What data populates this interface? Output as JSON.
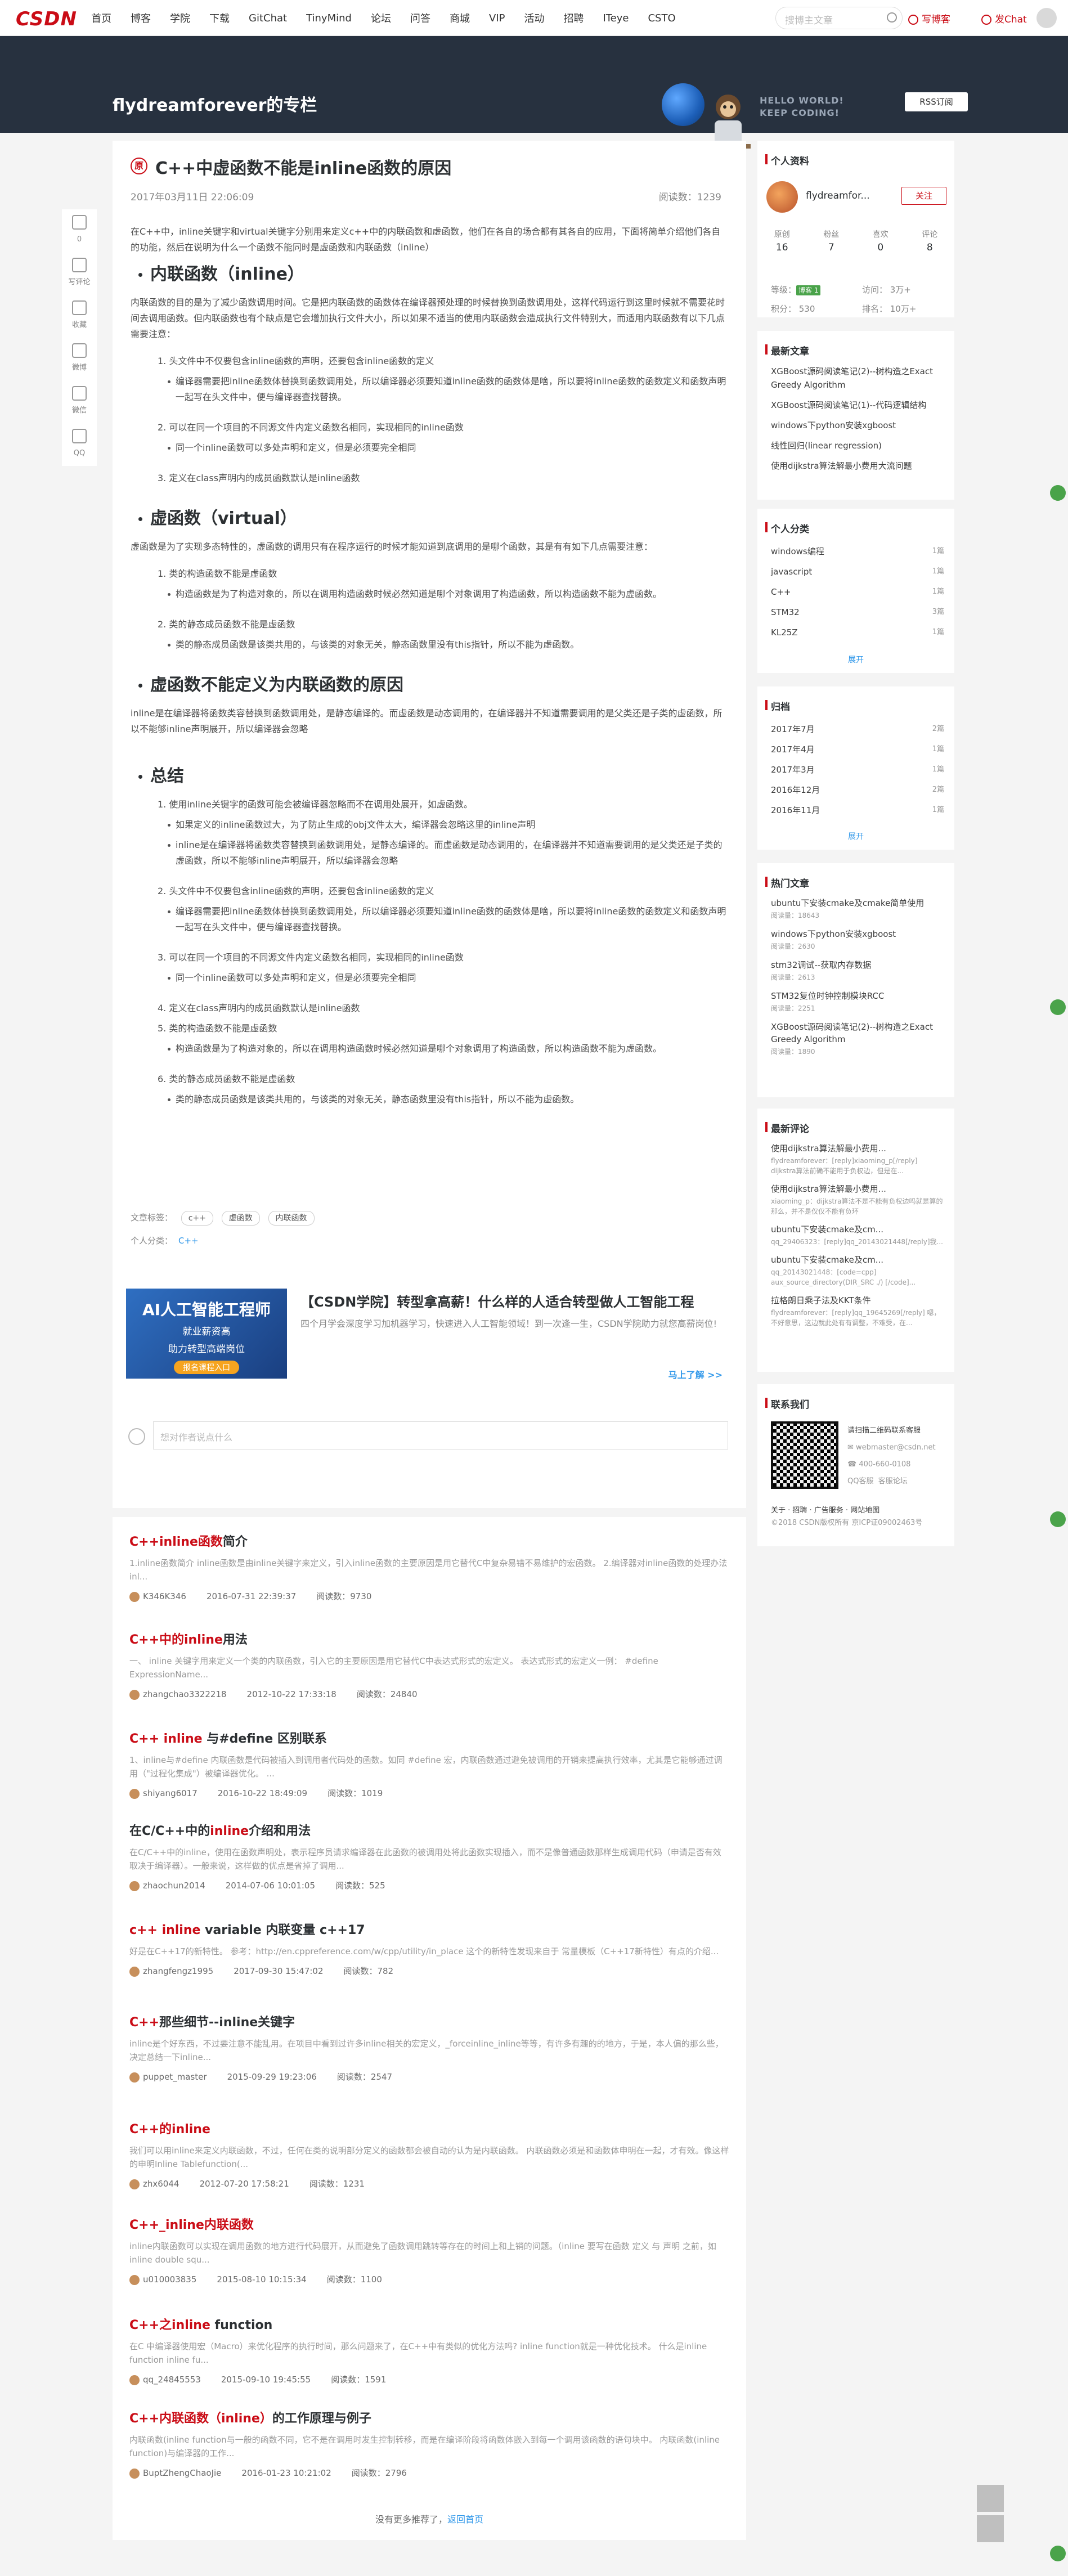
{
  "nav": {
    "logo": "CSDN",
    "links": [
      "首页",
      "博客",
      "学院",
      "下载",
      "GitChat",
      "TinyMind",
      "论坛",
      "问答",
      "商城",
      "VIP",
      "活动",
      "招聘",
      "ITeye",
      "CSTO"
    ],
    "search_placeholder": "搜博主文章",
    "write": "写博客",
    "chat": "发Chat"
  },
  "banner": {
    "title": "flydreamforever的专栏",
    "hello": [
      "HELLO WORLD!",
      "KEEP CODING!"
    ],
    "rss": "RSS订阅"
  },
  "lefttools": [
    {
      "icon": "thumb-up-icon",
      "label": "0"
    },
    {
      "icon": "comment-icon",
      "label": "写评论"
    },
    {
      "icon": "bookmark-icon",
      "label": "收藏"
    },
    {
      "icon": "weibo-icon",
      "label": "微博"
    },
    {
      "icon": "wechat-icon",
      "label": "微信"
    },
    {
      "icon": "qq-icon",
      "label": "QQ"
    }
  ],
  "article": {
    "badge": "原",
    "title": "C++中虚函数不能是inline函数的原因",
    "date": "2017年03月11日 22:06:09",
    "reads": "阅读数：1239",
    "intro": "在C++中，inline关键字和virtual关键字分别用来定义c++中的内联函数和虚函数，他们在各自的场合都有其各自的应用，下面将简单介绍他们各自的功能，然后在说明为什么一个函数不能同时是虚函数和内联函数（inline）",
    "s1_title": "内联函数（inline）",
    "s1_p": "内联函数的目的是为了减少函数调用时间。它是把内联函数的函数体在编译器预处理的时候替换到函数调用处，这样代码运行到这里时候就不需要花时间去调用函数。但内联函数也有个缺点是它会增加执行文件大小，所以如果不适当的使用内联函数会造成执行文件特别大，而适用内联函数有以下几点需要注意：",
    "s1_items": [
      {
        "level": 1,
        "text": "1. 头文件中不仅要包含inline函数的声明，还要包含inline函数的定义"
      },
      {
        "level": 2,
        "text": "编译器需要把inline函数体替换到函数调用处，所以编译器必须要知道inline函数的函数体是啥，所以要将inline函数的函数定义和函数声明一起写在头文件中，便与编译器查找替换。"
      },
      {
        "level": 1,
        "text": "2. 可以在同一个项目的不同源文件内定义函数名相同，实现相同的inline函数"
      },
      {
        "level": 2,
        "text": "同一个inline函数可以多处声明和定义，但是必须要完全相同"
      },
      {
        "level": 1,
        "text": "3. 定义在class声明内的成员函数默认是inline函数"
      }
    ],
    "s2_title": "虚函数（virtual）",
    "s2_p": "虚函数是为了实现多态特性的，虚函数的调用只有在程序运行的时候才能知道到底调用的是哪个函数，其是有有如下几点需要注意：",
    "s2_items": [
      {
        "level": 1,
        "text": "1. 类的构造函数不能是虚函数"
      },
      {
        "level": 2,
        "text": "构造函数是为了构造对象的，所以在调用构造函数时候必然知道是哪个对象调用了构造函数，所以构造函数不能为虚函数。"
      },
      {
        "level": 1,
        "text": "2. 类的静态成员函数不能是虚函数"
      },
      {
        "level": 2,
        "text": "类的静态成员函数是该类共用的，与该类的对象无关，静态函数里没有this指针，所以不能为虚函数。"
      }
    ],
    "s3_title": "虚函数不能定义为内联函数的原因",
    "s3_p": "inline是在编译器将函数类容替换到函数调用处，是静态编译的。而虚函数是动态调用的，在编译器并不知道需要调用的是父类还是子类的虚函数，所以不能够inline声明展开，所以编译器会忽略",
    "s4_title": "总结",
    "s4_items": [
      {
        "level": 1,
        "text": "1. 使用inline关键字的函数可能会被编译器忽略而不在调用处展开，如虚函数。"
      },
      {
        "level": 2,
        "text": "如果定义的inline函数过大，为了防止生成的obj文件太大，编译器会忽略这里的inline声明"
      },
      {
        "level": 2,
        "text": "inline是在编译器将函数类容替换到函数调用处，是静态编译的。而虚函数是动态调用的，在编译器并不知道需要调用的是父类还是子类的虚函数，所以不能够inline声明展开，所以编译器会忽略"
      },
      {
        "level": 1,
        "text": "2. 头文件中不仅要包含inline函数的声明，还要包含inline函数的定义"
      },
      {
        "level": 2,
        "text": "编译器需要把inline函数体替换到函数调用处，所以编译器必须要知道inline函数的函数体是啥，所以要将inline函数的函数定义和函数声明一起写在头文件中，便与编译器查找替换。"
      },
      {
        "level": 1,
        "text": "3. 可以在同一个项目的不同源文件内定义函数名相同，实现相同的inline函数"
      },
      {
        "level": 2,
        "text": "同一个inline函数可以多处声明和定义，但是必须要完全相同"
      },
      {
        "level": 1,
        "text": "4. 定义在class声明内的成员函数默认是inline函数"
      },
      {
        "level": 1,
        "text": "5. 类的构造函数不能是虚函数"
      },
      {
        "level": 2,
        "text": "构造函数是为了构造对象的，所以在调用构造函数时候必然知道是哪个对象调用了构造函数，所以构造函数不能为虚函数。"
      },
      {
        "level": 1,
        "text": "6. 类的静态成员函数不能是虚函数"
      },
      {
        "level": 2,
        "text": "类的静态成员函数是该类共用的，与该类的对象无关，静态函数里没有this指针，所以不能为虚函数。"
      }
    ],
    "tags_label": "文章标签：",
    "tags": [
      "c++",
      "虚函数",
      "内联函数"
    ],
    "category_label": "个人分类：",
    "category": "C++"
  },
  "ad": {
    "img_big": "AI人工智能工程师",
    "img_sm1": "就业薪资高",
    "img_sm2": "助力转型高端岗位",
    "img_btn": "报名课程入口",
    "title": "【CSDN学院】转型拿高薪！什么样的人适合转型做人工智能工程",
    "desc": "四个月学会深度学习加机器学习，快速进入人工智能领域！到一次逢一生，CSDN学院助力就您高薪岗位!",
    "more": "马上了解 >>"
  },
  "comment": {
    "placeholder": "想对作者说点什么"
  },
  "related": [
    {
      "title_pre": "",
      "title_hl": "C++inline函数",
      "title_post": "简介",
      "desc": "1.inline函数简介 inline函数是由inline关键字来定义，引入inline函数的主要原因是用它替代C中复杂易错不易维护的宏函数。 2.编译器对inline函数的处理办法 inl...",
      "user": "K346K346",
      "date": "2016-07-31 22:39:37",
      "reads": "阅读数：9730"
    },
    {
      "title_pre": "",
      "title_hl": "C++中的inline",
      "title_post": "用法",
      "desc": "一、 inline 关键字用来定义一个类的内联函数，引入它的主要原因是用它替代C中表达式形式的宏定义。         表达式形式的宏定义一例：    #define ExpressionName...",
      "user": "zhangchao3322218",
      "date": "2012-10-22 17:33:18",
      "reads": "阅读数：24840"
    },
    {
      "title_pre": "",
      "title_hl": "C++ inline",
      "title_post": " 与#define 区别联系",
      "desc": "1、inline与#define 内联函数是代码被插入到调用者代码处的函数。如同 #define 宏，内联函数通过避免被调用的开销来提高执行效率，尤其是它能够通过调用（\"过程化集成\"）被编译器优化。 ...",
      "user": "shiyang6017",
      "date": "2016-10-22 18:49:09",
      "reads": "阅读数：1019"
    },
    {
      "title_pre": "在C/C++中的",
      "title_hl": "inline",
      "title_post": "介绍和用法",
      "desc": "在C/C++中的inline，使用在函数声明处，表示程序员请求编译器在此函数的被调用处将此函数实现插入，而不是像普通函数那样生成调用代码（申请是否有效取决于编译器）。一般来说，这样做的优点是省掉了调用...",
      "user": "zhaochun2014",
      "date": "2014-07-06 10:01:05",
      "reads": "阅读数：525"
    },
    {
      "title_pre": "",
      "title_hl": "c++ inline",
      "title_post": " variable 内联变量 c++17",
      "desc": "好是在C++17的新特性。 参考：http://en.cppreference.com/w/cpp/utility/in_place 这个的新特性发现来自于 常量模板（C++17新特性）有点的介绍...",
      "user": "zhangfengz1995",
      "date": "2017-09-30 15:47:02",
      "reads": "阅读数：782"
    },
    {
      "title_pre": "",
      "title_hl": "C++",
      "title_post": "那些细节--inline关键字",
      "desc": "inline是个好东西，不过要注意不能乱用。在项目中看到过许多inline相关的宏定义，_forceinline_inline等等，有许多有趣的的地方，于是，本人偏的那么些，决定总结一下inline...",
      "user": "puppet_master",
      "date": "2015-09-29 19:23:06",
      "reads": "阅读数：2547"
    },
    {
      "title_pre": "",
      "title_hl": "C++的inline",
      "title_post": "",
      "desc": "我们可以用inline来定义内联函数，不过，任何在类的说明部分定义的函数都会被自动的认为是内联函数。 内联函数必须是和函数体申明在一起，才有效。像这样的申明Inline Tablefunction(...",
      "user": "zhx6044",
      "date": "2012-07-20 17:58:21",
      "reads": "阅读数：1231"
    },
    {
      "title_pre": "",
      "title_hl": "C++_inline内联函数",
      "title_post": "",
      "desc": "inline内联函数可以实现在调用函数的地方进行代码展开，从而避免了函数调用跳转等存在的时间上和上销的问题。（inline 要写在函数 定义 与 声明 之前，如 inline double squ...",
      "user": "u010003835",
      "date": "2015-08-10 10:15:34",
      "reads": "阅读数：1100"
    },
    {
      "title_pre": "",
      "title_hl": "C++之inline",
      "title_post": " function",
      "desc": "在C 中编译器使用宏（Macro）来优化程序的执行时间，那么问题来了，在C++中有类似的优化方法吗? inline function就是一种优化技术。 什么是inline function inline fu...",
      "user": "qq_24845553",
      "date": "2015-09-10 19:45:55",
      "reads": "阅读数：1591"
    },
    {
      "title_pre": "",
      "title_hl": "C++内联函数（inline）",
      "title_post": "的工作原理与例子",
      "desc": "内联函数(inline function与一般的函数不同，它不是在调用时发生控制转移，而是在编译阶段将函数体嵌入到每一个调用该函数的语句块中。 内联函数(inline function)与编译器的工作...",
      "user": "BuptZhengChaoJie",
      "date": "2016-01-23 10:21:02",
      "reads": "阅读数：2796"
    }
  ],
  "related_end": {
    "text": "没有更多推荐了，",
    "link": "返回首页"
  },
  "profile": {
    "head": "个人资料",
    "name": "flydreamfor...",
    "follow": "关注",
    "stats": [
      {
        "label": "原创",
        "value": "16"
      },
      {
        "label": "粉丝",
        "value": "7"
      },
      {
        "label": "喜欢",
        "value": "0"
      },
      {
        "label": "评论",
        "value": "8"
      }
    ],
    "grade_label": "等级：",
    "grade_badge": "博客 1",
    "points": "积分：  530",
    "visits": "访问：  3万+",
    "rank": "排名：  10万+"
  },
  "latest": {
    "head": "最新文章",
    "items": [
      "XGBoost源码阅读笔记(2)--树构造之Exact Greedy Algorithm",
      "XGBoost源码阅读笔记(1)--代码逻辑结构",
      "windows下python安装xgboost",
      "线性回归(linear regression)",
      "使用dijkstra算法解最小费用大流问题"
    ]
  },
  "categories": {
    "head": "个人分类",
    "items": [
      {
        "name": "windows编程",
        "count": "1篇"
      },
      {
        "name": "javascript",
        "count": "1篇"
      },
      {
        "name": "C++",
        "count": "1篇"
      },
      {
        "name": "STM32",
        "count": "3篇"
      },
      {
        "name": "KL25Z",
        "count": "1篇"
      }
    ],
    "expand": "展开"
  },
  "archive": {
    "head": "归档",
    "items": [
      {
        "name": "2017年7月",
        "count": "2篇"
      },
      {
        "name": "2017年4月",
        "count": "1篇"
      },
      {
        "name": "2017年3月",
        "count": "1篇"
      },
      {
        "name": "2016年12月",
        "count": "2篇"
      },
      {
        "name": "2016年11月",
        "count": "1篇"
      }
    ],
    "expand": "展开"
  },
  "hot": {
    "head": "热门文章",
    "items": [
      {
        "title": "ubuntu下安装cmake及cmake简单使用",
        "reads": "阅读量：18643"
      },
      {
        "title": "windows下python安装xgboost",
        "reads": "阅读量：2630"
      },
      {
        "title": "stm32调试--获取内存数据",
        "reads": "阅读量：2613"
      },
      {
        "title": "STM32复位时钟控制模块RCC",
        "reads": "阅读量：2251"
      },
      {
        "title": "XGBoost源码阅读笔记(2)--树构造之Exact Greedy Algorithm",
        "reads": "阅读量：1890"
      }
    ]
  },
  "comments": {
    "head": "最新评论",
    "items": [
      {
        "title": "使用dijkstra算法解最小费用...",
        "desc": "flydreamforever：[reply]xiaoming_p[/reply] dijkstra算法前确不能用于负权边，但是在..."
      },
      {
        "title": "使用dijkstra算法解最小费用...",
        "desc": "xiaoming_p：dijkstra算法不是不能有负权边吗就是算的那么，并不是仅仅不能有负环"
      },
      {
        "title": "ubuntu下安装cmake及cm...",
        "desc": "qq_29406323：[reply]qq_20143021448[/reply]我..."
      },
      {
        "title": "ubuntu下安装cmake及cm...",
        "desc": "qq_20143021448：[code=cpp] aux_source_directory(DIR_SRC ./) [/code]..."
      },
      {
        "title": "拉格朗日乘子法及KKT条件",
        "desc": "flydreamforever：[reply]qq_19645269[/reply] 嗯，不好意思，这边就此处有有调整，不难受，在..."
      }
    ]
  },
  "contact": {
    "head": "联系我们",
    "scan": "请扫描二维码联系客服",
    "email": "webmaster@csdn.net",
    "phone": "400-660-0108",
    "qq": "QQ客服",
    "service": "客服论坛",
    "foot1": "关于 · 招聘 · 广告服务 · 网站地图",
    "foot2": "©2018 CSDN版权所有 京ICP证09002463号"
  }
}
